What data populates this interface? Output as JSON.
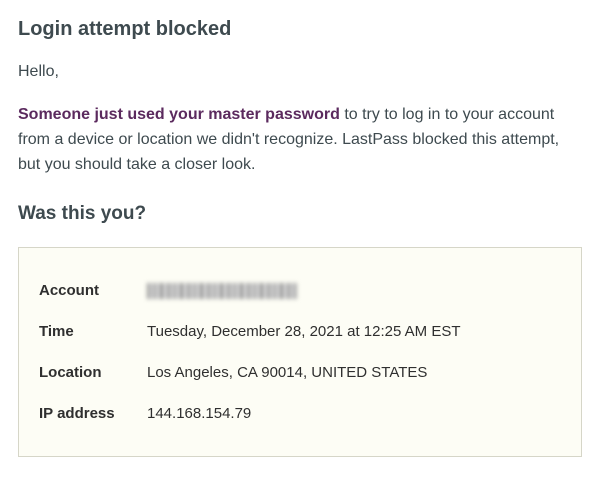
{
  "header": {
    "title": "Login attempt blocked"
  },
  "greeting": "Hello,",
  "warning": {
    "bold_prefix": "Someone just used your master password",
    "rest": " to try to log in to your account from a device or location we didn't recognize. LastPass blocked this attempt, but you should take a closer look."
  },
  "subtitle": "Was this you?",
  "details": {
    "account": {
      "label": "Account",
      "value": "[redacted]"
    },
    "time": {
      "label": "Time",
      "value": "Tuesday, December 28, 2021 at 12:25 AM EST"
    },
    "location": {
      "label": "Location",
      "value": "Los Angeles, CA 90014, UNITED STATES"
    },
    "ip": {
      "label": "IP address",
      "value": "144.168.154.79"
    }
  }
}
